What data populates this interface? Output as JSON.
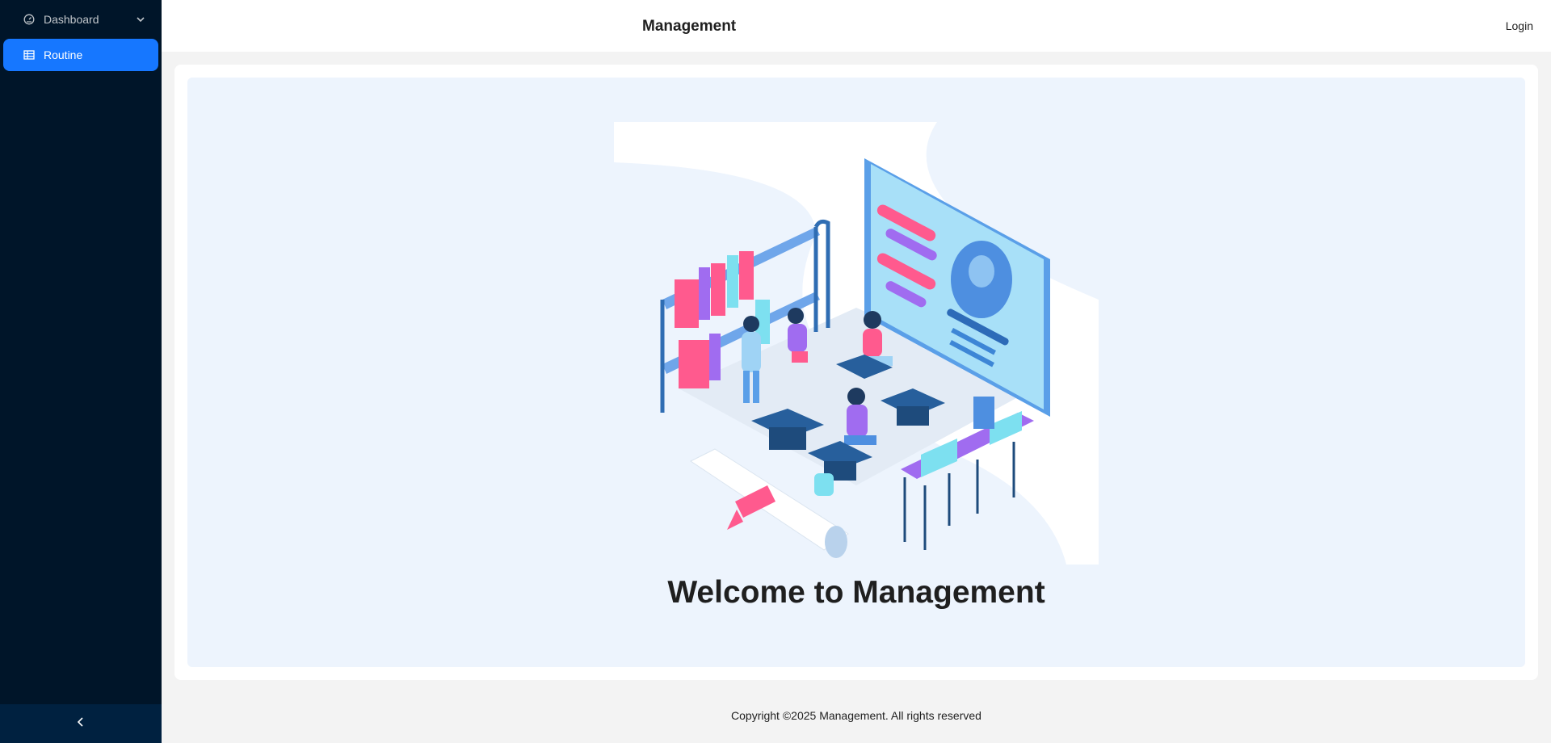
{
  "sidebar": {
    "items": [
      {
        "label": "Dashboard",
        "icon": "dashboard-icon",
        "expandable": true
      },
      {
        "label": "Routine",
        "icon": "table-icon",
        "selected": true
      }
    ],
    "collapse_icon": "chevron-left-icon"
  },
  "header": {
    "title": "Management",
    "login_label": "Login"
  },
  "main": {
    "illustration": "education-classroom-illustration",
    "welcome_text": "Welcome to Management"
  },
  "footer": {
    "copyright": "Copyright ©2025 Management. All rights reserved"
  },
  "colors": {
    "sidebar_bg": "#001529",
    "accent": "#1677ff",
    "hero_bg": "#edf4fd"
  }
}
